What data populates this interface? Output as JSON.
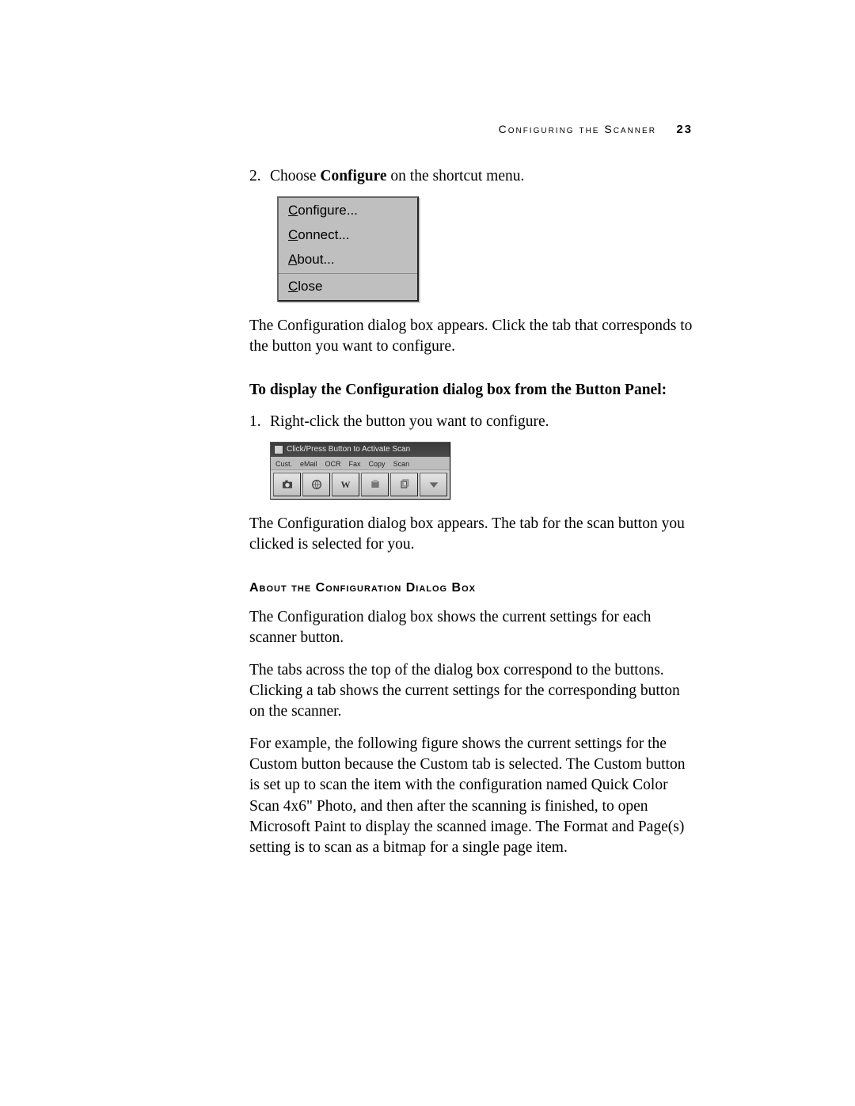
{
  "header": {
    "running_title": "Configuring the Scanner",
    "page_number": "23"
  },
  "step2": {
    "num": "2.",
    "pre": "Choose ",
    "bold": "Configure",
    "post": " on the shortcut menu."
  },
  "context_menu": {
    "configure": "Configure...",
    "connect": "Connect...",
    "about": "About...",
    "close": "Close"
  },
  "after_menu_para": "The Configuration dialog box appears. Click the tab that corresponds to the button you want to configure.",
  "section_label": "To display the Configuration dialog box from the Button Panel:",
  "step1b": {
    "num": "1.",
    "text": "Right-click the button you want to configure."
  },
  "button_panel": {
    "title": "Click/Press Button to Activate Scan",
    "tabs": [
      "Cust.",
      "eMail",
      "OCR",
      "Fax",
      "Copy",
      "Scan"
    ]
  },
  "after_panel_para": "The Configuration dialog box appears. The tab for the scan button you clicked is selected for you.",
  "subheading": "About the Configuration Dialog Box",
  "body_para1": "The Configuration dialog box shows the current settings for each scanner button.",
  "body_para2": "The tabs across the top of the dialog box correspond to the buttons. Clicking a tab shows the current settings for the corresponding button on the scanner.",
  "body_para3": "For example, the following figure shows the current settings for the Custom button because the Custom tab is selected. The Custom button is set up to scan the item with the configuration named Quick Color Scan 4x6\" Photo, and then after the scanning is finished, to open Microsoft Paint to display the scanned image. The Format and Page(s) setting is to scan as a bitmap for a single page item."
}
